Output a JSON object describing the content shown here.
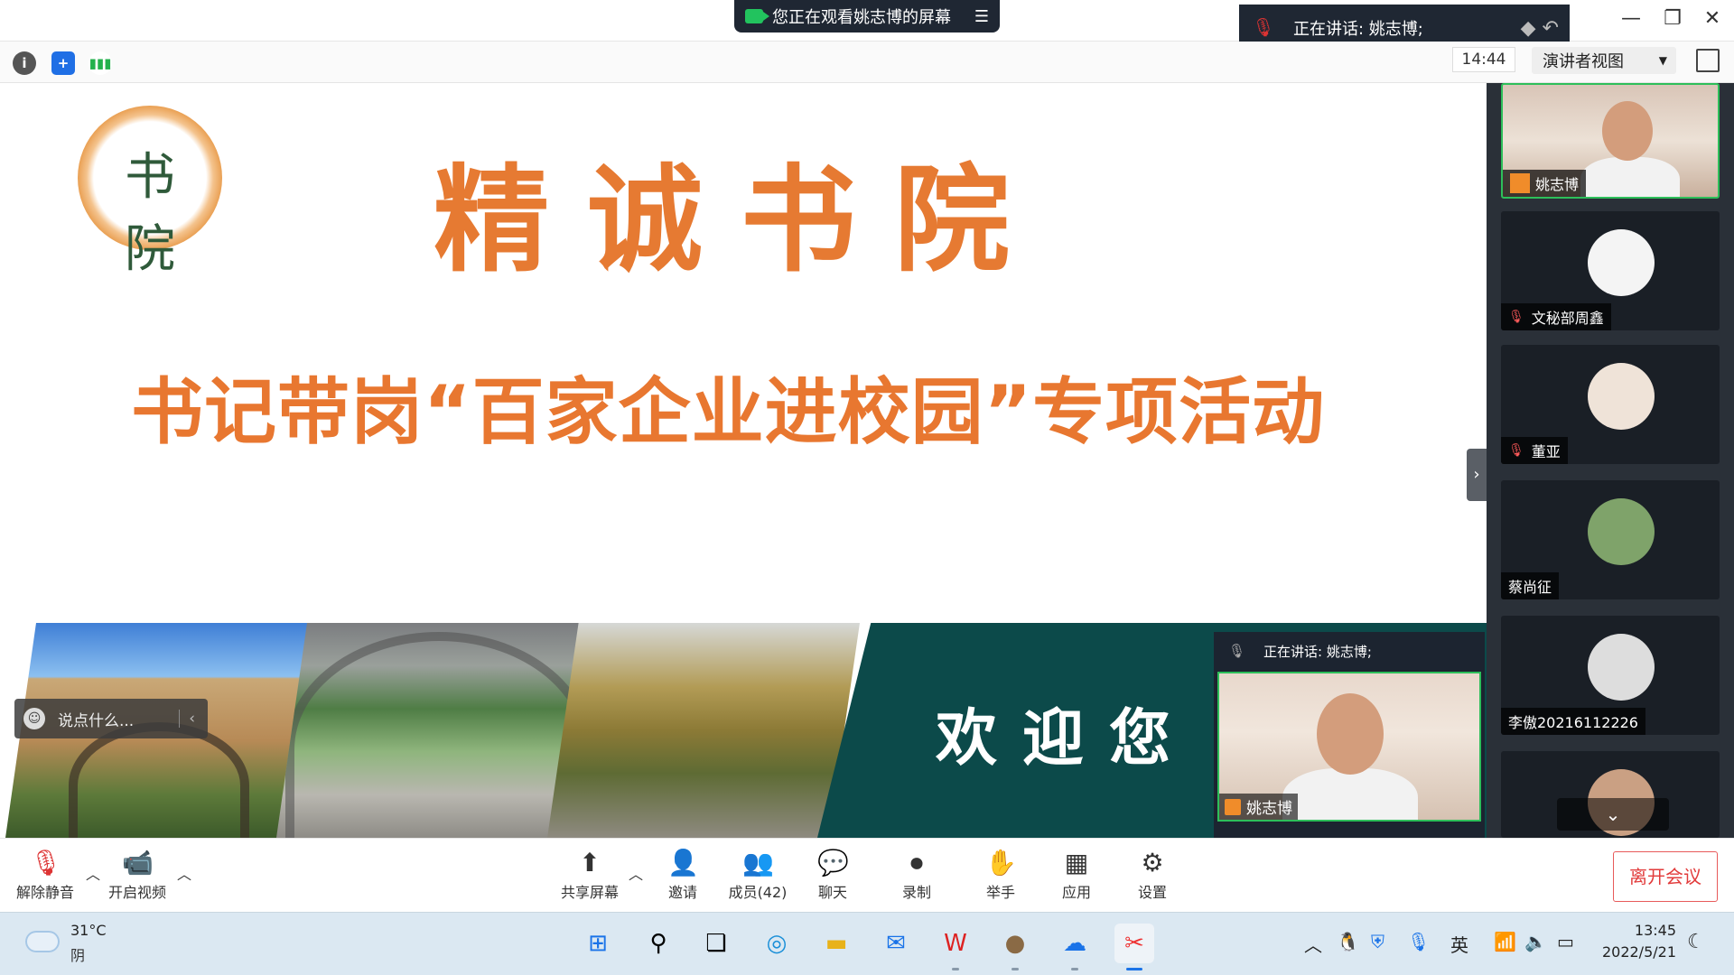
{
  "topbar": {
    "share_notice": "您正在观看姚志博的屏幕",
    "speaking_label": "正在讲话: 姚志博;"
  },
  "infobar": {
    "time": "14:44",
    "view_mode": "演讲者视图"
  },
  "slide": {
    "title": "精诚书院",
    "subtitle": "书记带岗“百家企业进校园”专项活动",
    "welcome": "欢迎您",
    "logo_text": "书院"
  },
  "chat_box": {
    "placeholder": "说点什么..."
  },
  "speaker_float": {
    "speaking_label": "正在讲话: 姚志博;",
    "name": "姚志博"
  },
  "participants": [
    {
      "name": "姚志博",
      "muted": false,
      "host": true
    },
    {
      "name": "文秘部周鑫",
      "muted": true
    },
    {
      "name": "董亚",
      "muted": true
    },
    {
      "name": "蔡尚征",
      "muted": false
    },
    {
      "name": "李傲20216112226",
      "muted": false
    },
    {
      "name": "",
      "muted": false
    }
  ],
  "toolbar": {
    "unmute": "解除静音",
    "start_video": "开启视频",
    "share_screen": "共享屏幕",
    "invite": "邀请",
    "members": "成员(42)",
    "chat": "聊天",
    "record": "录制",
    "raise_hand": "举手",
    "apps": "应用",
    "settings": "设置",
    "leave": "离开会议"
  },
  "taskbar": {
    "temperature": "31°C",
    "weather": "阴",
    "ime": "英",
    "time": "13:45",
    "date": "2022/5/21"
  },
  "colors": {
    "accent_orange": "#e67a32",
    "teal": "#0c4a4a",
    "leave_red": "#e23b3b",
    "active_green": "#2dbf5a"
  }
}
